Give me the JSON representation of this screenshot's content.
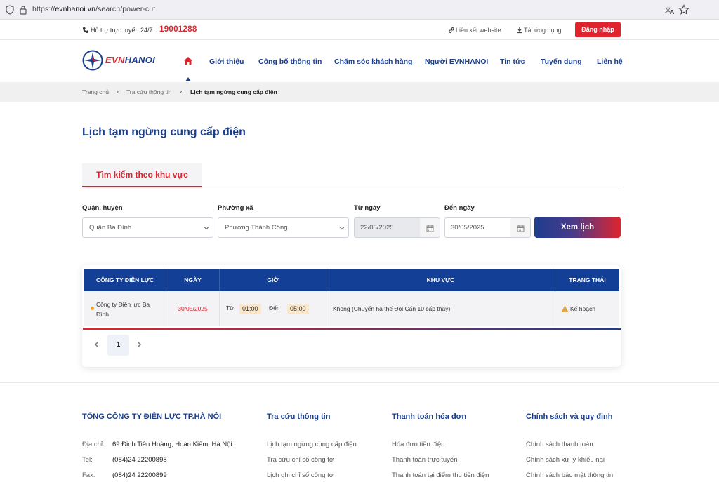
{
  "browser": {
    "url_prefix": "https://",
    "url_host": "evnhanoi.vn",
    "url_path": "/search/power-cut"
  },
  "topbar": {
    "hotline_label": "Hỗ trợ trực tuyến 24/7:",
    "hotline_number": "19001288",
    "links_label": "Liên kết website",
    "app_label": "Tải ứng dụng",
    "login_label": "Đăng nhập"
  },
  "logo": {
    "evn": "EVN",
    "hanoi": "HANOI"
  },
  "nav": {
    "items": [
      "Giới thiệu",
      "Công bố thông tin",
      "Chăm sóc khách hàng",
      "Người EVNHANOI",
      "Tin tức",
      "Tuyển dụng",
      "Liên hệ"
    ]
  },
  "breadcrumb": {
    "items": [
      "Trang chủ",
      "Tra cứu thông tin",
      "Lịch tạm ngừng cung cấp điện"
    ]
  },
  "page": {
    "title": "Lịch tạm ngừng cung cấp điện",
    "tab": "Tìm kiếm theo khu vực"
  },
  "filters": {
    "district_label": "Quận, huyện",
    "district_value": "Quận Ba Đình",
    "ward_label": "Phường xã",
    "ward_value": "Phường Thành Công",
    "from_label": "Từ ngày",
    "from_value": "22/05/2025",
    "to_label": "Đến ngày",
    "to_value": "30/05/2025",
    "submit_label": "Xem lịch"
  },
  "table": {
    "headers": [
      "CÔNG TY ĐIỆN LỰC",
      "NGÀY",
      "GIỜ",
      "KHU VỰC",
      "TRẠNG THÁI"
    ],
    "rows": [
      {
        "company": "Công ty Điện lực Ba Đình",
        "date": "30/05/2025",
        "from_label": "Từ",
        "from_time": "01:00",
        "to_label": "Đến",
        "to_time": "05:00",
        "area": "Không (Chuyển hạ thế Đội Cấn 10 cấp thay)",
        "status": "Kế hoạch"
      }
    ]
  },
  "pagination": {
    "current": "1"
  },
  "footer": {
    "company_title": "TỔNG CÔNG TY ĐIỆN LỰC TP.HÀ NỘI",
    "address_label": "Địa chỉ:",
    "address_value": "69 Đinh Tiên Hoàng, Hoàn Kiếm, Hà Nội",
    "tel_label": "Tel:",
    "tel_value": "(084)24 22200898",
    "fax_label": "Fax:",
    "fax_value": "(084)24 22200899",
    "lookup_title": "Tra cứu thông tin",
    "lookup_links": [
      "Lịch tạm ngừng cung cấp điện",
      "Tra cứu chỉ số công tơ",
      "Lịch ghi chỉ số công tơ"
    ],
    "payment_title": "Thanh toán hóa đơn",
    "payment_links": [
      "Hóa đơn tiền điện",
      "Thanh toán trực tuyến",
      "Thanh toán tại điểm thu tiền điện"
    ],
    "policy_title": "Chính sách và quy định",
    "policy_links": [
      "Chính sách thanh toán",
      "Chính sách xử lý khiếu nại",
      "Chính sách bảo mật thông tin"
    ]
  },
  "colors": {
    "brand_blue": "#1a3e8c",
    "brand_red": "#e0242d",
    "table_header": "#143f96"
  }
}
